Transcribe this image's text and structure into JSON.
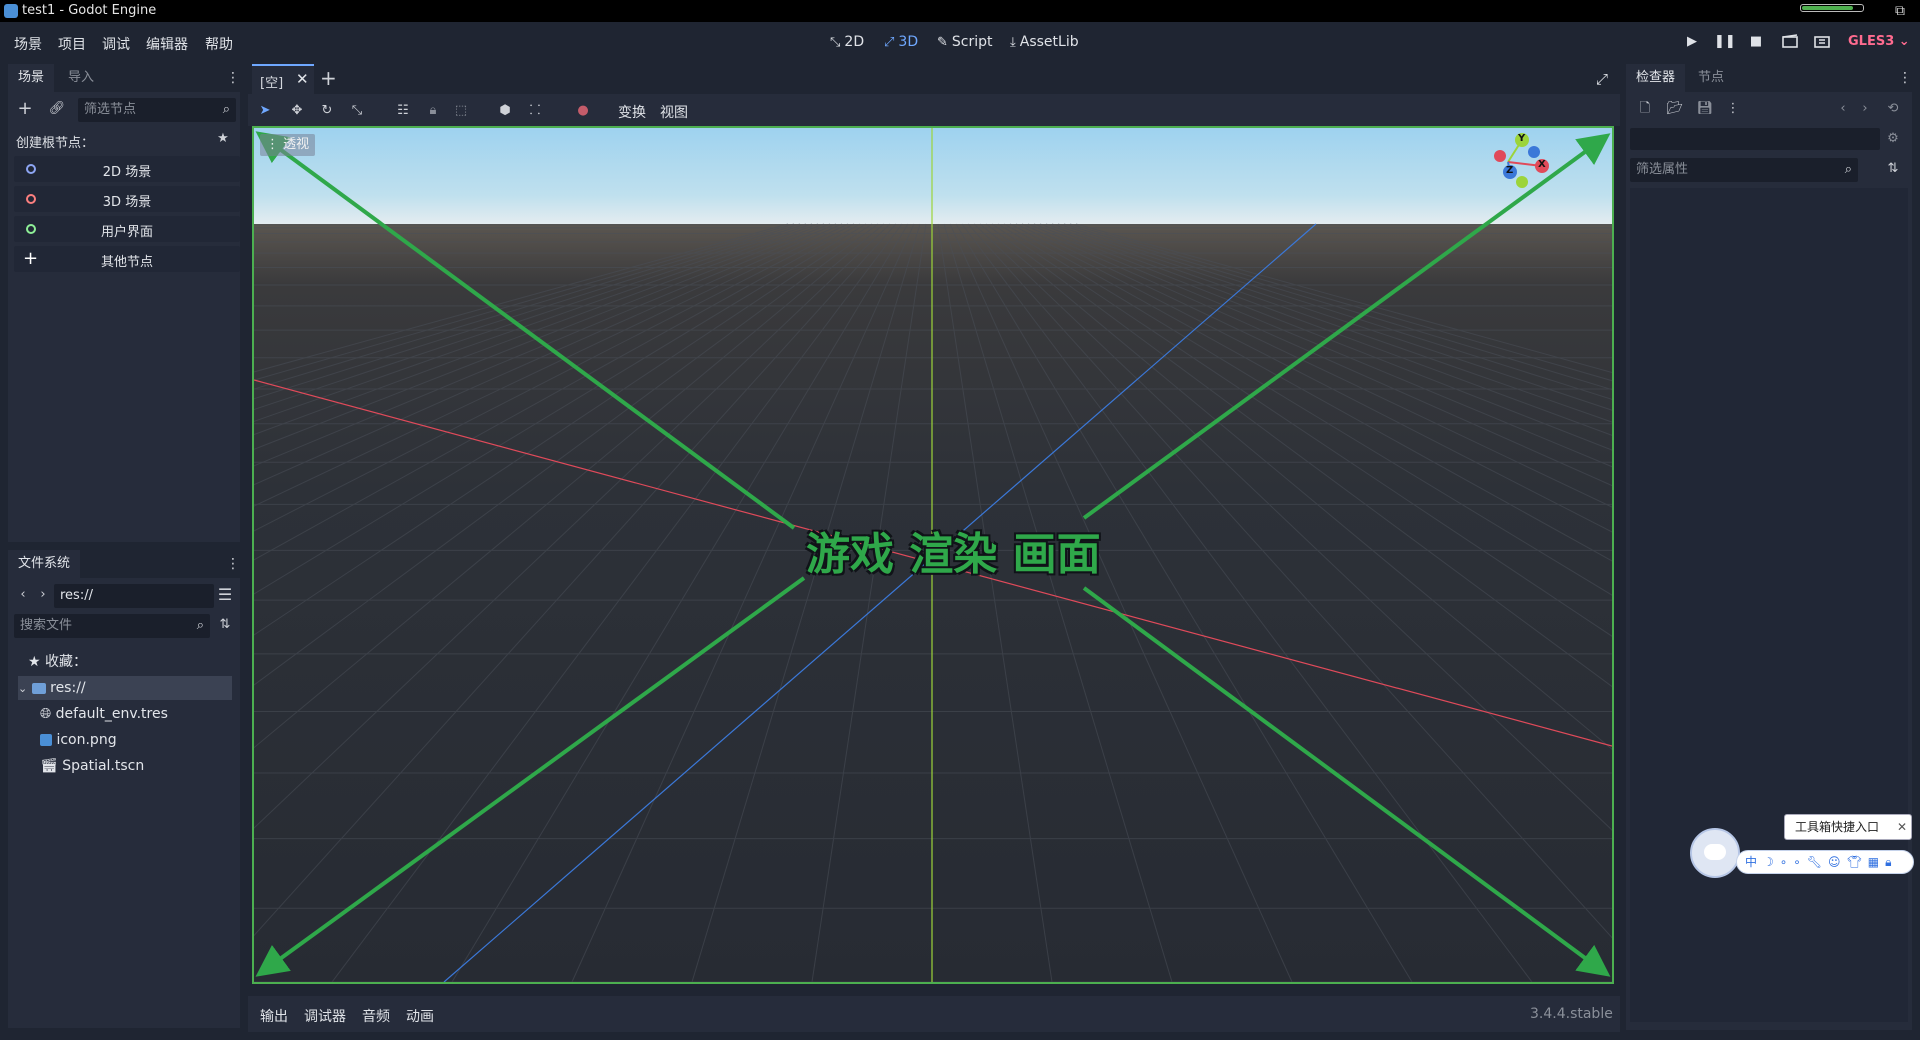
{
  "titlebar": {
    "title": "test1 - Godot Engine",
    "progress_fraction": 0.85
  },
  "menu": [
    "场景",
    "项目",
    "调试",
    "编辑器",
    "帮助"
  ],
  "workspaces": [
    {
      "glyph": "⤡",
      "label": "2D"
    },
    {
      "glyph": "⤢",
      "label": "3D"
    },
    {
      "glyph": "✎",
      "label": "Script"
    },
    {
      "glyph": "⤓",
      "label": "AssetLib"
    }
  ],
  "renderer": "GLES3",
  "scene_panel": {
    "tabs": [
      "场景",
      "导入"
    ],
    "filter_placeholder": "筛选节点",
    "create_root_label": "创建根节点：",
    "root_buttons": [
      {
        "label": "2D 场景",
        "color": "#8da5f3"
      },
      {
        "label": "3D 场景",
        "color": "#fc7f7f"
      },
      {
        "label": "用户界面",
        "color": "#8eef97"
      },
      {
        "label": "其他节点",
        "color": "#ffffff"
      }
    ]
  },
  "filesystem_panel": {
    "tab": "文件系统",
    "path": "res://",
    "search_placeholder": "搜索文件",
    "favorites_label": "收藏：",
    "root_label": "res://",
    "files": [
      {
        "name": "default_env.tres",
        "icon": "globe-icon"
      },
      {
        "name": "icon.png",
        "icon": "image-icon"
      },
      {
        "name": "Spatial.tscn",
        "icon": "clapper-icon"
      }
    ]
  },
  "viewport": {
    "tab_label": "[空]",
    "toolbar_menus": [
      "变换",
      "视图"
    ],
    "perspective_label": "透视",
    "overlay_text": "游戏 渲染 画面",
    "axis_labels": {
      "x": "X",
      "y": "Y",
      "z": "Z"
    },
    "colors": {
      "x_axis": "#e04a5a",
      "z_axis": "#3b78d8",
      "y_axis": "#9cd43a",
      "arrow": "#2fa84a"
    }
  },
  "bottom_panel": {
    "tabs": [
      "输出",
      "调试器",
      "音频",
      "动画"
    ],
    "version": "3.4.4.stable"
  },
  "inspector_panel": {
    "tabs": [
      "检查器",
      "节点"
    ],
    "filter_placeholder": "筛选属性"
  },
  "ime_toolbar": {
    "tooltip": "工具箱快捷入口",
    "lang_label": "中",
    "icons": [
      "moon-icon",
      "dots-icon",
      "wrench-icon",
      "smile-icon",
      "shirt-icon",
      "grid-icon",
      "lock-icon"
    ]
  }
}
